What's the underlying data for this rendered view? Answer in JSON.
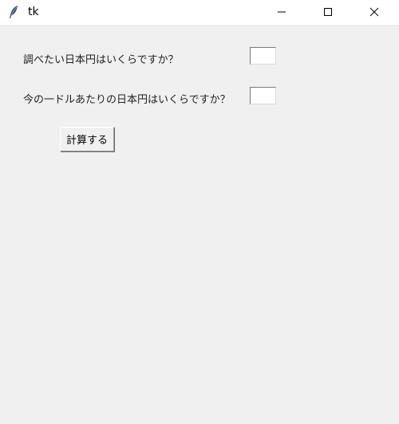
{
  "window": {
    "title": "tk",
    "icon": "tk-feather-icon",
    "controls": [
      "minimize-icon",
      "maximize-icon",
      "close-icon"
    ]
  },
  "form": {
    "question1": "調べたい日本円はいくらですか？",
    "question2": "今の一ドルあたりの日本円はいくらですか？",
    "input1_value": "",
    "input2_value": "",
    "calculate_label": "計算する"
  },
  "colors": {
    "window_bg": "#f0f0f0",
    "titlebar_bg": "#ffffff"
  }
}
